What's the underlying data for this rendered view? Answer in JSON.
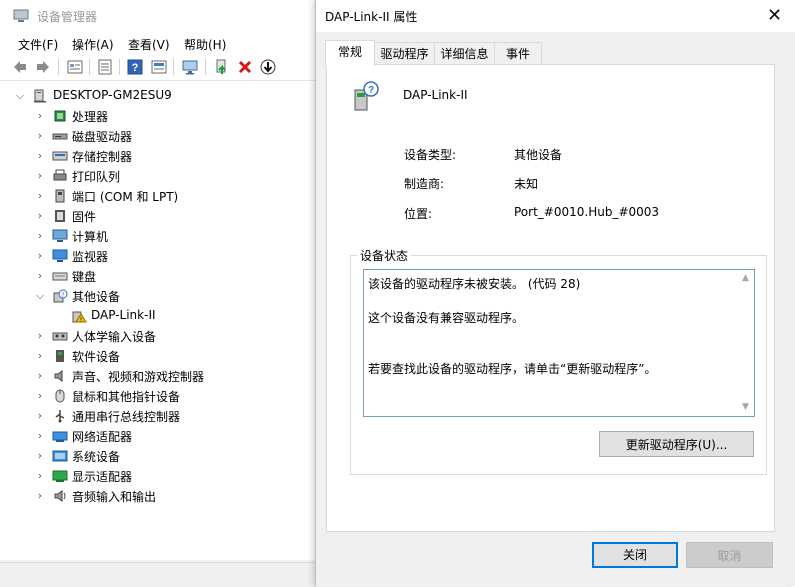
{
  "device_manager": {
    "title": "设备管理器",
    "menu": [
      "文件(F)",
      "操作(A)",
      "查看(V)",
      "帮助(H)"
    ],
    "toolbar": {
      "back_icon": "arrow-left-icon",
      "forward_icon": "arrow-right-icon",
      "properties_icon": "properties-icon",
      "show_hide_icon": "list-icon",
      "help_icon": "help-icon",
      "update_icon": "update-driver-icon",
      "scan_icon": "monitor-scan-icon",
      "enable_icon": "enable-device-icon",
      "uninstall_icon": "red-x-icon",
      "download_icon": "down-arrow-circle-icon"
    },
    "tree": {
      "root": "DESKTOP-GM2ESU9",
      "items": [
        {
          "label": "处理器",
          "icon": "processor-icon"
        },
        {
          "label": "磁盘驱动器",
          "icon": "disk-icon"
        },
        {
          "label": "存储控制器",
          "icon": "storage-icon"
        },
        {
          "label": "打印队列",
          "icon": "printer-icon"
        },
        {
          "label": "端口 (COM 和 LPT)",
          "icon": "port-icon"
        },
        {
          "label": "固件",
          "icon": "firmware-icon"
        },
        {
          "label": "计算机",
          "icon": "computer-icon"
        },
        {
          "label": "监视器",
          "icon": "monitor-icon"
        },
        {
          "label": "键盘",
          "icon": "keyboard-icon"
        },
        {
          "label": "其他设备",
          "icon": "other-devices-icon"
        },
        {
          "label": "DAP-Link-II",
          "icon": "warning-device-icon"
        },
        {
          "label": "人体学输入设备",
          "icon": "hid-icon"
        },
        {
          "label": "软件设备",
          "icon": "software-icon"
        },
        {
          "label": "声音、视频和游戏控制器",
          "icon": "speaker-icon"
        },
        {
          "label": "鼠标和其他指针设备",
          "icon": "mouse-icon"
        },
        {
          "label": "通用串行总线控制器",
          "icon": "usb-icon"
        },
        {
          "label": "网络适配器",
          "icon": "network-icon"
        },
        {
          "label": "系统设备",
          "icon": "system-icon"
        },
        {
          "label": "显示适配器",
          "icon": "display-icon"
        },
        {
          "label": "音频输入和输出",
          "icon": "audio-icon"
        }
      ]
    }
  },
  "dialog": {
    "title": "DAP-Link-II 属性",
    "close_glyph": "✕",
    "tabs": [
      "常规",
      "驱动程序",
      "详细信息",
      "事件"
    ],
    "device_name": "DAP-Link-II",
    "props": [
      {
        "label": "设备类型:",
        "value": "其他设备"
      },
      {
        "label": "制造商:",
        "value": "未知"
      },
      {
        "label": "位置:",
        "value": "Port_#0010.Hub_#0003"
      }
    ],
    "status_legend": "设备状态",
    "status_text": "该设备的驱动程序未被安装。 (代码 28)\n\n这个设备没有兼容驱动程序。\n\n\n若要查找此设备的驱动程序，请单击“更新驱动程序”。",
    "update_button": "更新驱动程序(U)...",
    "ok_button": "关闭",
    "cancel_button": "取消",
    "accent_color": "#0078d7"
  }
}
